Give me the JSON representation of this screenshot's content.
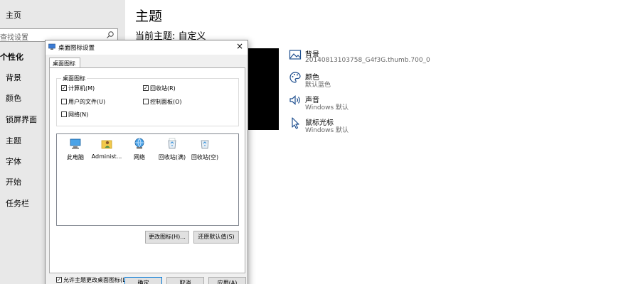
{
  "nav": {
    "home": "主页",
    "search_placeholder": "查找设置",
    "category": "个性化",
    "items": [
      "背景",
      "颜色",
      "锁屏界面",
      "主题",
      "字体",
      "开始",
      "任务栏"
    ]
  },
  "main": {
    "title": "主题",
    "current_theme": "当前主题: 自定义",
    "options": [
      {
        "title": "背景",
        "subtitle": "20140813103758_G4f3G.thumb.700_0",
        "icon": "picture-icon"
      },
      {
        "title": "颜色",
        "subtitle": "默认蓝色",
        "icon": "palette-icon"
      },
      {
        "title": "声音",
        "subtitle": "Windows 默认",
        "icon": "speaker-icon"
      },
      {
        "title": "鼠标光标",
        "subtitle": "Windows 默认",
        "icon": "cursor-icon"
      }
    ]
  },
  "dialog": {
    "title": "桌面图标设置",
    "close": "×",
    "tab": "桌面图标",
    "group_label": "桌面图标",
    "checkboxes": [
      {
        "label": "计算机(M)",
        "checked": true
      },
      {
        "label": "回收站(R)",
        "checked": true
      },
      {
        "label": "用户的文件(U)",
        "checked": false
      },
      {
        "label": "控制面板(O)",
        "checked": false
      },
      {
        "label": "网络(N)",
        "checked": false
      }
    ],
    "icons": [
      {
        "label": "此电脑",
        "icon": "computer-icon"
      },
      {
        "label": "Administ...",
        "icon": "user-folder-icon"
      },
      {
        "label": "网络",
        "icon": "network-icon"
      },
      {
        "label": "回收站(满)",
        "icon": "recycle-bin-full-icon"
      },
      {
        "label": "回收站(空)",
        "icon": "recycle-bin-empty-icon"
      }
    ],
    "change_icon": "更改图标(H)...",
    "restore_default": "还原默认值(S)",
    "allow_themes": "允许主题更改桌面图标(L)",
    "allow_themes_checked": true,
    "ok": "确定",
    "cancel": "取消",
    "apply": "应用(A)"
  },
  "colors": {
    "accent": "#0078d7",
    "nav_bg": "#e8e8e8",
    "dialog_bg": "#f0f0f0"
  }
}
